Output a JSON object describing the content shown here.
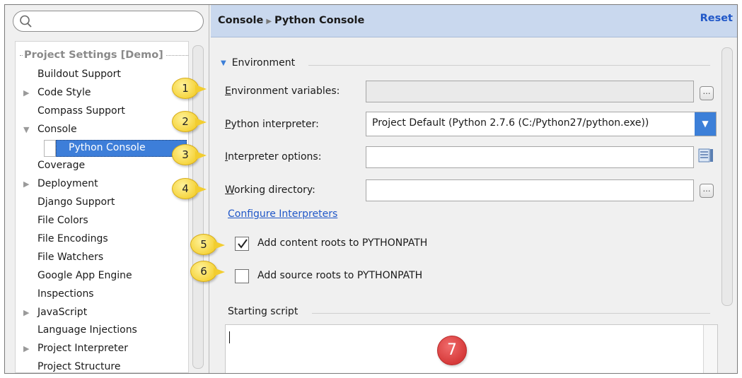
{
  "colors": {
    "accent": "#3d7ed9",
    "link": "#2057c8",
    "callout": "#f5d33a",
    "badge_red": "#d63a3a",
    "header_bg": "#c9d8ee"
  },
  "sidebar": {
    "search_icon": "search-icon",
    "header": "Project Settings [Demo]",
    "items": [
      {
        "label": "Buildout Support",
        "arrow": ""
      },
      {
        "label": "Code Style",
        "arrow": "▶"
      },
      {
        "label": "Compass Support",
        "arrow": ""
      },
      {
        "label": "Console",
        "arrow": "▼"
      },
      {
        "label": "Python Console",
        "arrow": "",
        "selected": true
      },
      {
        "label": "Coverage",
        "arrow": ""
      },
      {
        "label": "Deployment",
        "arrow": "▶"
      },
      {
        "label": "Django Support",
        "arrow": ""
      },
      {
        "label": "File Colors",
        "arrow": ""
      },
      {
        "label": "File Encodings",
        "arrow": ""
      },
      {
        "label": "File Watchers",
        "arrow": ""
      },
      {
        "label": "Google App Engine",
        "arrow": ""
      },
      {
        "label": "Inspections",
        "arrow": ""
      },
      {
        "label": "JavaScript",
        "arrow": "▶"
      },
      {
        "label": "Language Injections",
        "arrow": ""
      },
      {
        "label": "Project Interpreter",
        "arrow": "▶"
      },
      {
        "label": "Project Structure",
        "arrow": ""
      }
    ]
  },
  "header": {
    "crumb_parent": "Console",
    "crumb_current": "Python Console",
    "reset": "Reset"
  },
  "env": {
    "section_title": "Environment",
    "env_vars_label": "Environment variables:",
    "env_vars_value": "",
    "interpreter_label": "Python interpreter:",
    "interpreter_value": "Project Default (Python 2.7.6 (C:/Python27/python.exe))",
    "options_label": "Interpreter options:",
    "options_value": "",
    "workdir_label": "Working directory:",
    "workdir_value": "",
    "configure_link": "Configure Interpreters",
    "content_roots_label": "Add content roots to PYTHONPATH",
    "content_roots_checked": true,
    "source_roots_label": "Add source roots to PYTHONPATH",
    "source_roots_checked": false,
    "starting_script_title": "Starting script",
    "starting_script_value": ""
  },
  "callouts": [
    "1",
    "2",
    "3",
    "4",
    "5",
    "6",
    "7"
  ]
}
